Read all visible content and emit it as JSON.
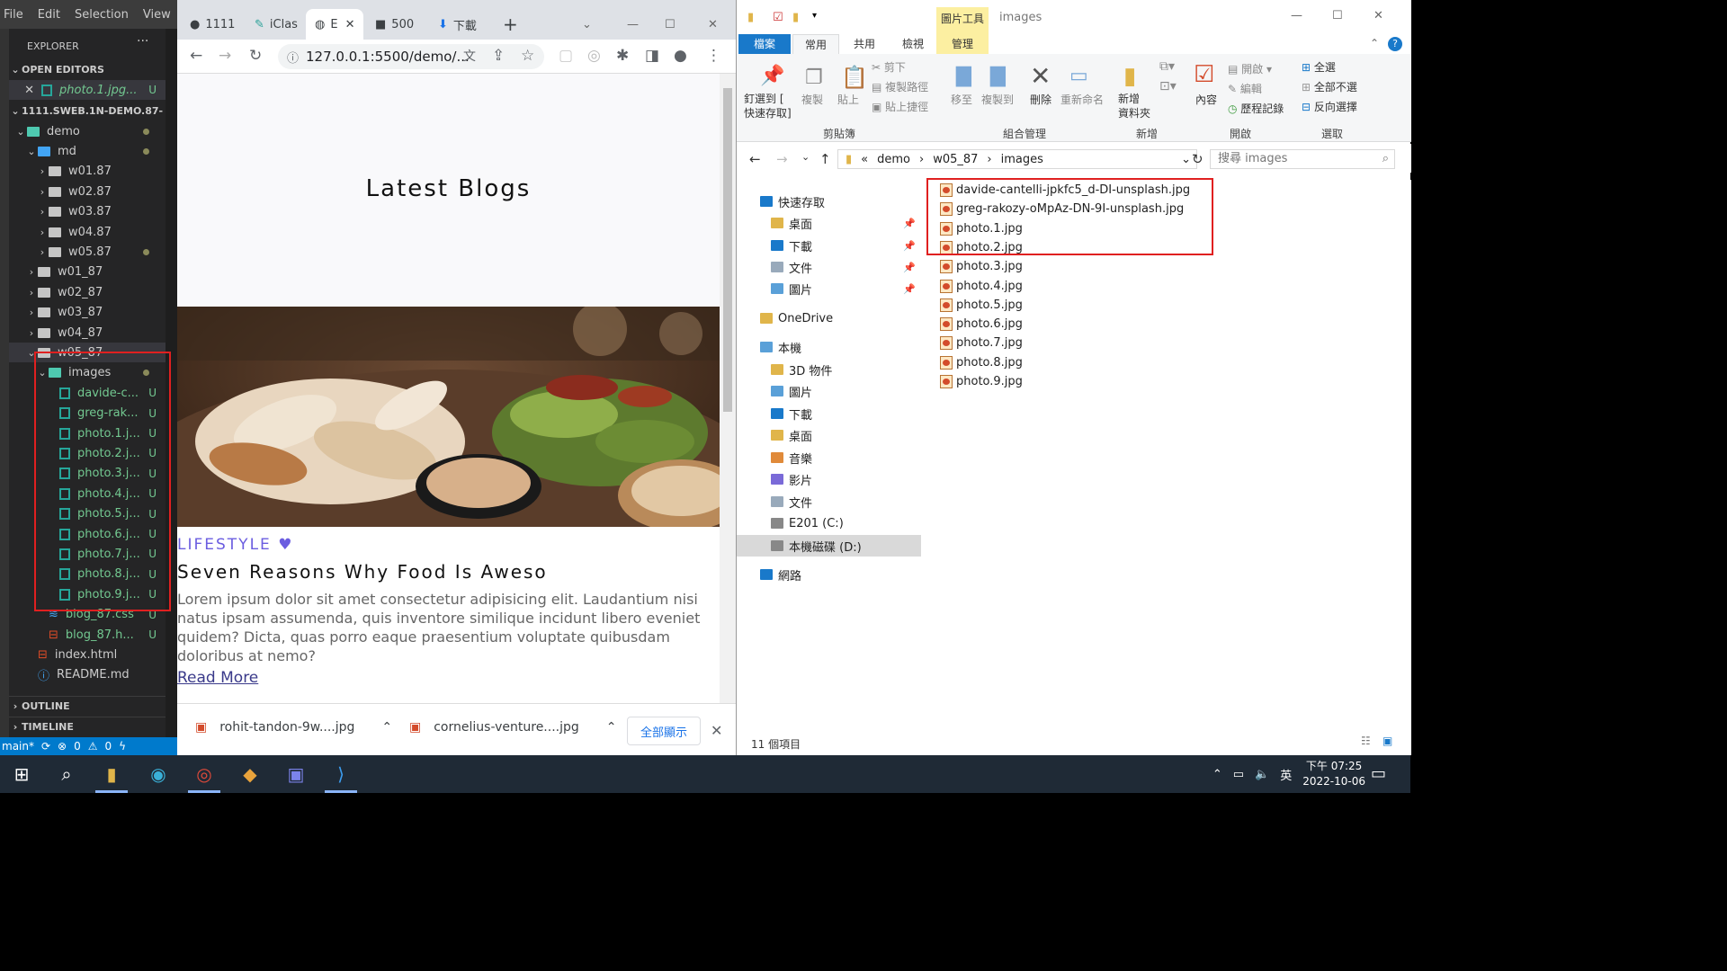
{
  "vscode": {
    "menu": [
      "File",
      "Edit",
      "Selection",
      "View"
    ],
    "explorer_title": "EXPLORER",
    "more": "···",
    "open_editors_title": "OPEN EDITORS",
    "open_editor": {
      "close": "✕",
      "name": "photo.1.jpg...",
      "badge": "U"
    },
    "project_title": "1111.SWEB.1N-DEMO.87-",
    "tree": [
      {
        "label": "demo",
        "kind": "folder-teal",
        "open": true,
        "badge": "dot"
      },
      {
        "label": "md",
        "kind": "folder-blue",
        "open": true,
        "badge": "dot"
      },
      {
        "label": "w01.87",
        "kind": "folder",
        "open": false,
        "badge": ""
      },
      {
        "label": "w02.87",
        "kind": "folder",
        "open": false,
        "badge": ""
      },
      {
        "label": "w03.87",
        "kind": "folder",
        "open": false,
        "badge": ""
      },
      {
        "label": "w04.87",
        "kind": "folder",
        "open": false,
        "badge": ""
      },
      {
        "label": "w05.87",
        "kind": "folder",
        "open": false,
        "badge": "dot"
      },
      {
        "label": "w01_87",
        "kind": "folder",
        "open": false,
        "badge": ""
      },
      {
        "label": "w02_87",
        "kind": "folder",
        "open": false,
        "badge": ""
      },
      {
        "label": "w03_87",
        "kind": "folder",
        "open": false,
        "badge": ""
      },
      {
        "label": "w04_87",
        "kind": "folder",
        "open": false,
        "badge": ""
      },
      {
        "label": "w05_87",
        "kind": "folder",
        "open": true,
        "badge": ""
      },
      {
        "label": "images",
        "kind": "folder-teal",
        "open": true,
        "badge": "dot"
      },
      {
        "label": "davide-c...",
        "kind": "image",
        "badge": "U"
      },
      {
        "label": "greg-rak...",
        "kind": "image",
        "badge": "U"
      },
      {
        "label": "photo.1.j...",
        "kind": "image",
        "badge": "U"
      },
      {
        "label": "photo.2.j...",
        "kind": "image",
        "badge": "U"
      },
      {
        "label": "photo.3.j...",
        "kind": "image",
        "badge": "U"
      },
      {
        "label": "photo.4.j...",
        "kind": "image",
        "badge": "U"
      },
      {
        "label": "photo.5.j...",
        "kind": "image",
        "badge": "U"
      },
      {
        "label": "photo.6.j...",
        "kind": "image",
        "badge": "U"
      },
      {
        "label": "photo.7.j...",
        "kind": "image",
        "badge": "U"
      },
      {
        "label": "photo.8.j...",
        "kind": "image",
        "badge": "U"
      },
      {
        "label": "photo.9.j...",
        "kind": "image",
        "badge": "U"
      },
      {
        "label": "blog_87.css",
        "kind": "css",
        "badge": "U"
      },
      {
        "label": "blog_87.h...",
        "kind": "html",
        "badge": "U"
      },
      {
        "label": "index.html",
        "kind": "html",
        "badge": ""
      },
      {
        "label": "README.md",
        "kind": "info",
        "badge": ""
      }
    ],
    "outline": "OUTLINE",
    "timeline": "TIMELINE",
    "status": {
      "branch": "main*",
      "errors": "0",
      "warnings": "0"
    }
  },
  "chrome": {
    "tabs": [
      "1111",
      "iClas",
      "E",
      "500",
      "下載"
    ],
    "url": "127.0.0.1:5500/demo/...",
    "page": {
      "heading": "Latest Blogs",
      "category": "LIFESTYLE",
      "title": "Seven Reasons Why Food Is Aweso",
      "body": "Lorem ipsum dolor sit amet consectetur adipisicing elit. Laudantium nisi natus ipsam assumenda, quis inventore similique incidunt libero eveniet quidem? Dicta, quas porro eaque praesentium voluptate quibusdam doloribus at nemo?",
      "read_more": "Read More"
    },
    "downloads": [
      "rohit-tandon-9w....jpg",
      "cornelius-venture....jpg"
    ],
    "show_all": "全部顯示"
  },
  "explorer": {
    "ribbon_context": "圖片工具",
    "window_title": "images",
    "tabs": [
      "檔案",
      "常用",
      "共用",
      "檢視",
      "管理"
    ],
    "ribbon": {
      "pin": "釘選到 [\n快速存取]",
      "copy": "複製",
      "paste": "貼上",
      "cut": "剪下",
      "copy_path": "複製路徑",
      "paste_shortcut": "貼上捷徑",
      "move_to": "移至",
      "copy_to": "複製到",
      "delete": "刪除",
      "rename": "重新命名",
      "new_folder": "新增\n資料夾",
      "properties": "內容",
      "open": "開啟",
      "edit": "編輯",
      "history": "歷程記錄",
      "select_all": "全選",
      "select_none": "全部不選",
      "invert": "反向選擇",
      "groups": [
        "剪貼簿",
        "組合管理",
        "新增",
        "開啟",
        "選取"
      ]
    },
    "breadcrumb": [
      "«",
      "demo",
      "w05_87",
      "images"
    ],
    "search_placeholder": "搜尋 images",
    "nav": [
      {
        "label": "快速存取",
        "indent": 1,
        "icon": "star",
        "pin": false
      },
      {
        "label": "桌面",
        "indent": 2,
        "icon": "folder",
        "pin": true
      },
      {
        "label": "下載",
        "indent": 2,
        "icon": "download",
        "pin": true
      },
      {
        "label": "文件",
        "indent": 2,
        "icon": "doc",
        "pin": true
      },
      {
        "label": "圖片",
        "indent": 2,
        "icon": "pic",
        "pin": true
      },
      {
        "label": "OneDrive",
        "indent": 1,
        "icon": "folder",
        "pin": false
      },
      {
        "label": "本機",
        "indent": 1,
        "icon": "pc",
        "pin": false
      },
      {
        "label": "3D 物件",
        "indent": 2,
        "icon": "folder",
        "pin": false
      },
      {
        "label": "圖片",
        "indent": 2,
        "icon": "pic",
        "pin": false
      },
      {
        "label": "下載",
        "indent": 2,
        "icon": "download",
        "pin": false
      },
      {
        "label": "桌面",
        "indent": 2,
        "icon": "folder",
        "pin": false
      },
      {
        "label": "音樂",
        "indent": 2,
        "icon": "music",
        "pin": false
      },
      {
        "label": "影片",
        "indent": 2,
        "icon": "video",
        "pin": false
      },
      {
        "label": "文件",
        "indent": 2,
        "icon": "doc",
        "pin": false
      },
      {
        "label": "E201 (C:)",
        "indent": 2,
        "icon": "drive",
        "pin": false
      },
      {
        "label": "本機磁碟 (D:)",
        "indent": 2,
        "icon": "drive",
        "pin": false,
        "selected": true
      },
      {
        "label": "網路",
        "indent": 1,
        "icon": "net",
        "pin": false
      }
    ],
    "files": [
      "davide-cantelli-jpkfc5_d-DI-unsplash.jpg",
      "greg-rakozy-oMpAz-DN-9I-unsplash.jpg",
      "photo.1.jpg",
      "photo.2.jpg",
      "photo.3.jpg",
      "photo.4.jpg",
      "photo.5.jpg",
      "photo.6.jpg",
      "photo.7.jpg",
      "photo.8.jpg",
      "photo.9.jpg"
    ],
    "status": "11 個項目"
  },
  "taskbar": {
    "ime": "英",
    "time": "下午 07:25",
    "date": "2022-10-06"
  }
}
